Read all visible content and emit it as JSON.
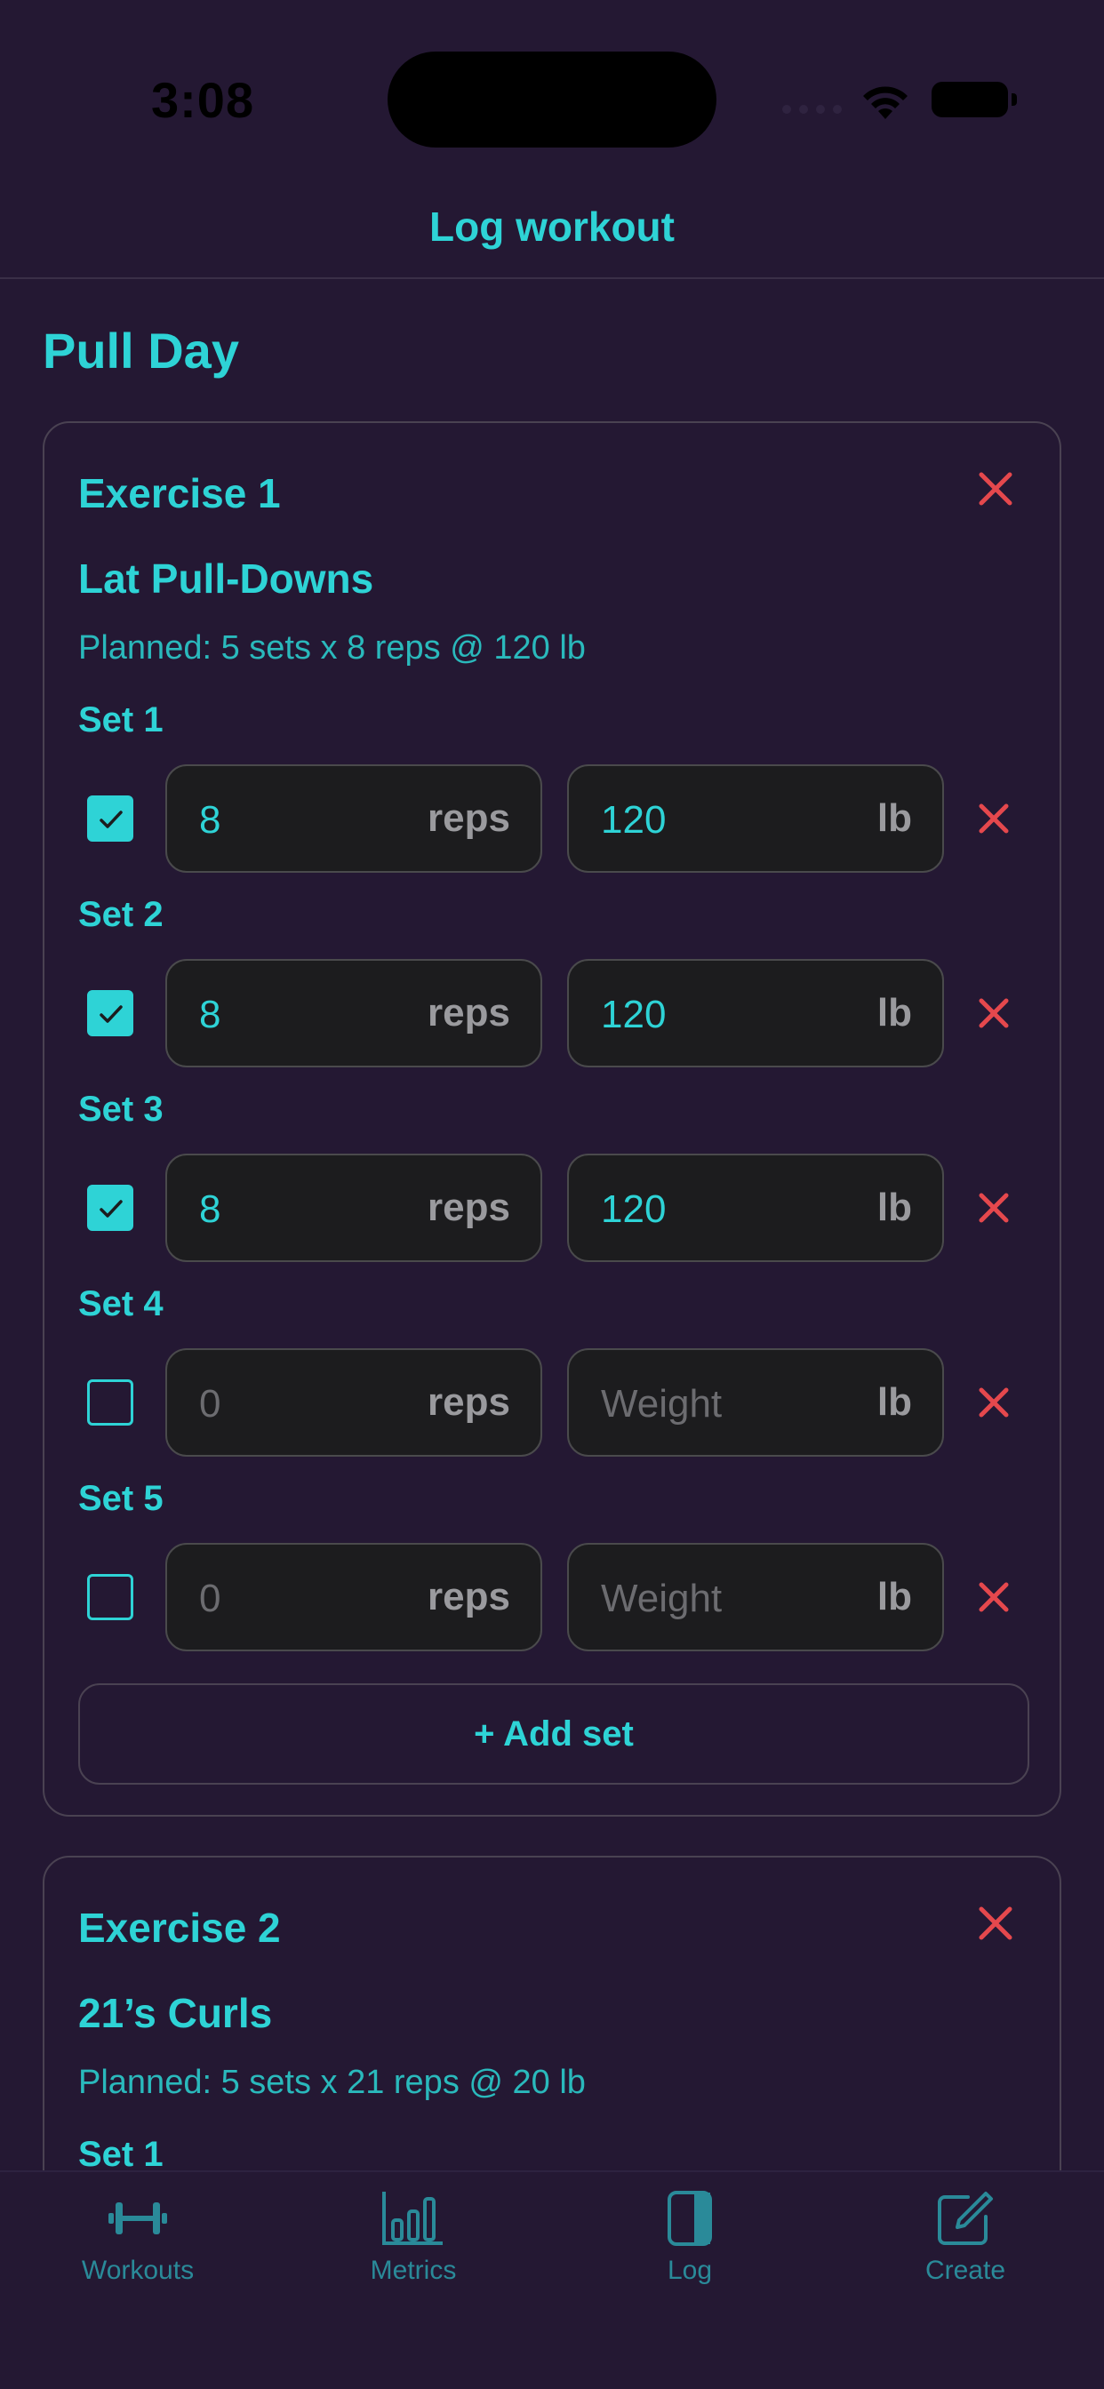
{
  "status_bar": {
    "time": "3:08"
  },
  "nav": {
    "title": "Log workout"
  },
  "workout": {
    "name": "Pull Day"
  },
  "exercises": [
    {
      "label": "Exercise 1",
      "name": "Lat Pull-Downs",
      "planned": "Planned: 5 sets x 8 reps @ 120 lb",
      "sets": [
        {
          "label": "Set 1",
          "done": true,
          "reps": "8",
          "weight": "120"
        },
        {
          "label": "Set 2",
          "done": true,
          "reps": "8",
          "weight": "120"
        },
        {
          "label": "Set 3",
          "done": true,
          "reps": "8",
          "weight": "120"
        },
        {
          "label": "Set 4",
          "done": false,
          "reps_placeholder": "0",
          "weight_placeholder": "Weight"
        },
        {
          "label": "Set 5",
          "done": false,
          "reps_placeholder": "0",
          "weight_placeholder": "Weight"
        }
      ],
      "add_set_label": "+ Add set"
    },
    {
      "label": "Exercise 2",
      "name": "21’s Curls",
      "planned": "Planned: 5 sets x 21 reps @ 20 lb",
      "sets": [
        {
          "label": "Set 1"
        }
      ]
    }
  ],
  "units": {
    "reps": "reps",
    "weight": "lb"
  },
  "tabs": [
    {
      "label": "Workouts",
      "icon": "dumbbell-icon"
    },
    {
      "label": "Metrics",
      "icon": "bar-chart-icon"
    },
    {
      "label": "Log",
      "icon": "sidebar-book-icon"
    },
    {
      "label": "Create",
      "icon": "compose-icon"
    }
  ],
  "colors": {
    "accent": "#2ed3d6",
    "danger": "#e5484d",
    "background": "#241833",
    "field": "#1c1c1e"
  }
}
